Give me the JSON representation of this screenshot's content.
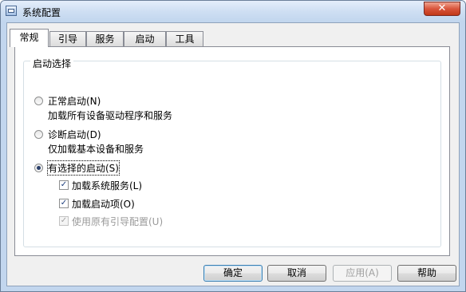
{
  "window": {
    "title": "系统配置",
    "close_glyph": "✕"
  },
  "tabs": [
    {
      "label": "常规",
      "active": true
    },
    {
      "label": "引导",
      "active": false
    },
    {
      "label": "服务",
      "active": false
    },
    {
      "label": "启动",
      "active": false
    },
    {
      "label": "工具",
      "active": false
    }
  ],
  "startup_group": {
    "label": "启动选择",
    "options": [
      {
        "label": "正常启动(N)",
        "description": "加载所有设备驱动程序和服务",
        "selected": false
      },
      {
        "label": "诊断启动(D)",
        "description": "仅加载基本设备和服务",
        "selected": false
      },
      {
        "label": "有选择的启动(S)",
        "selected": true
      }
    ],
    "selective_items": [
      {
        "label": "加载系统服务(L)",
        "checked": true,
        "enabled": true
      },
      {
        "label": "加载启动项(O)",
        "checked": true,
        "enabled": true
      },
      {
        "label": "使用原有引导配置(U)",
        "checked": true,
        "enabled": false
      }
    ]
  },
  "buttons": {
    "ok": "确定",
    "cancel": "取消",
    "apply": "应用(A)",
    "help": "帮助"
  },
  "glyphs": {
    "check": "✓"
  }
}
